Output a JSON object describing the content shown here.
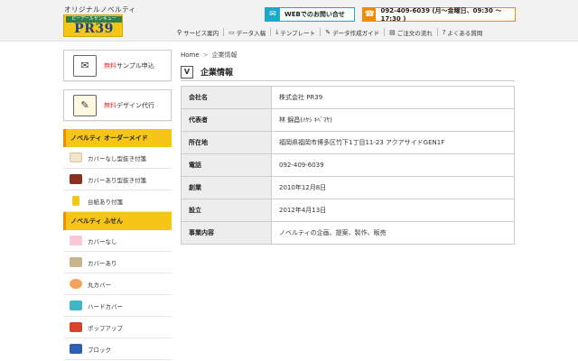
{
  "header": {
    "tagline": "オリジナルノベルティ",
    "logo_sub": "ピーアールサンキュー",
    "logo_main": "PR39",
    "contact_icon": "mail-icon",
    "contact_label": "WEBでのお問い合せ",
    "tel_icon": "phone-icon",
    "tel_label": "092-409-6039 (月〜金曜日、09:30 〜 17:30 )",
    "accent_contact": "#1ca9c9",
    "accent_tel": "#f08c00",
    "nav": [
      {
        "icon": "pin-icon",
        "label": "サービス案内"
      },
      {
        "icon": "folder-icon",
        "label": "データ入稿"
      },
      {
        "icon": "download-icon",
        "label": "テンプレート"
      },
      {
        "icon": "pencil-icon",
        "label": "データ作成ガイド"
      },
      {
        "icon": "clipboard-icon",
        "label": "ご注文の流れ"
      },
      {
        "icon": "question-icon",
        "label": "よくある質問"
      }
    ]
  },
  "sidebar": {
    "cards": [
      {
        "icon": "envelope-icon",
        "red": "無料",
        "label": "サンプル申込"
      },
      {
        "icon": "design-icon",
        "red": "無料",
        "label": "デザイン代行"
      }
    ],
    "sections": [
      {
        "title": "ノベルティ オーダーメイド",
        "items": [
          "カバーなし型抜き付箋",
          "カバーあり型抜き付箋",
          "台紙あり付箋"
        ]
      },
      {
        "title": "ノベルティ ふせん",
        "items": [
          "カバーなし",
          "カバーあり",
          "丸カバー",
          "ハードカバー",
          "ポップアップ",
          "ブロック"
        ]
      }
    ]
  },
  "breadcrumb": {
    "home": "Home",
    "sep": ">",
    "current": "企業情報"
  },
  "page_title": {
    "icon": "vs-icon",
    "text": "企業情報"
  },
  "company_table": [
    {
      "key": "会社名",
      "value": "株式会社 PR39"
    },
    {
      "key": "代表者",
      "value": "林 錦昌(ﾊﾔｼ ｷﾍﾞﾏｻ)"
    },
    {
      "key": "所在地",
      "value": "福岡県福岡市博多区竹下1丁目11-23 アクアサイドGEN1F"
    },
    {
      "key": "電話",
      "value": "092-409-6039"
    },
    {
      "key": "創業",
      "value": "2010年12月8日"
    },
    {
      "key": "設立",
      "value": "2012年4月13日"
    },
    {
      "key": "事業内容",
      "value": "ノベルティの企画、提案、製作、販売"
    }
  ]
}
